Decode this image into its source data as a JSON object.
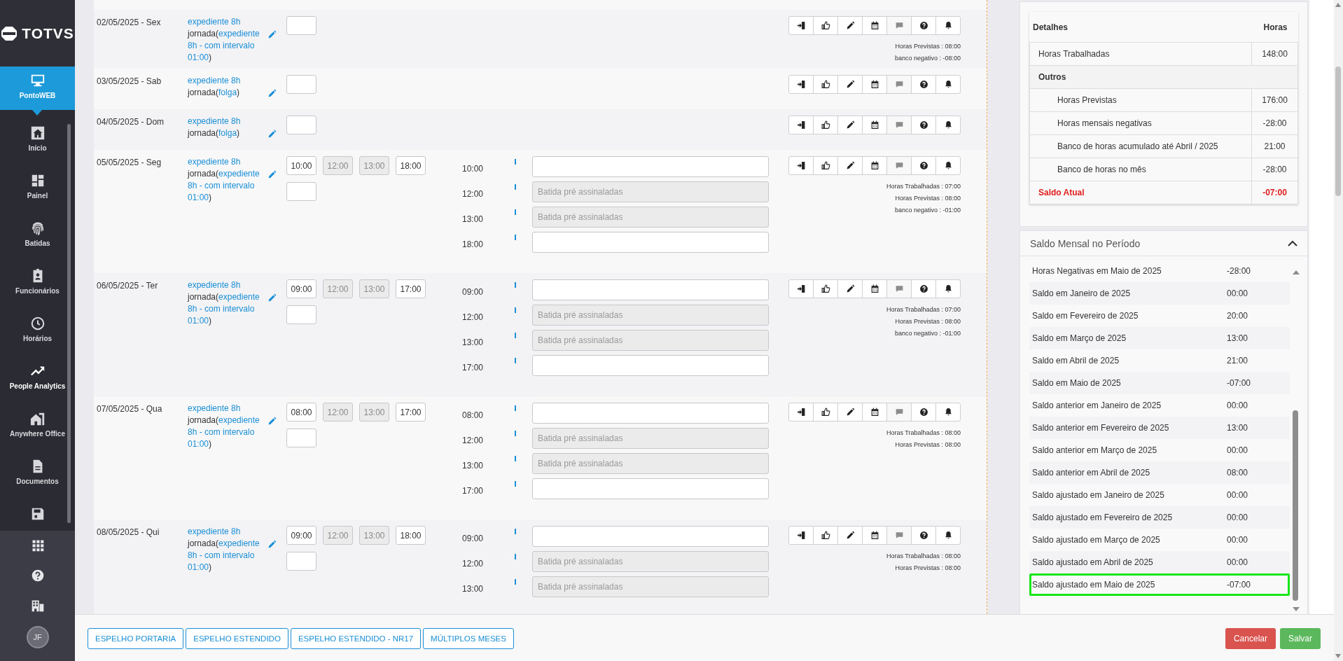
{
  "sidebar": {
    "brand": "TOTVS",
    "nav": [
      {
        "label": "PontoWEB",
        "selected": true,
        "highlighted": false
      },
      {
        "label": "Início",
        "selected": false,
        "highlighted": false
      },
      {
        "label": "Painel",
        "selected": false,
        "highlighted": false
      },
      {
        "label": "Batidas",
        "selected": false,
        "highlighted": false
      },
      {
        "label": "Funcionários",
        "selected": false,
        "highlighted": false
      },
      {
        "label": "Horários",
        "selected": false,
        "highlighted": false
      },
      {
        "label": "People Analytics",
        "selected": false,
        "highlighted": true
      },
      {
        "label": "Anywhere Office",
        "selected": false,
        "highlighted": false
      },
      {
        "label": "Documentos",
        "selected": false,
        "highlighted": false
      },
      {
        "selected": false,
        "highlighted": false
      }
    ],
    "user": {
      "initials": "JF"
    }
  },
  "days": [
    {
      "date": "02/05/2025 - Sex",
      "schedule": "expediente 8h",
      "jornada": "jornada(",
      "jornada_link": "expediente 8h - com intervalo 01:00",
      "jornada_close": ")",
      "inputs": [
        [
          {
            "disabled": false
          }
        ]
      ],
      "actions": [
        {
          "disabled": false
        },
        {
          "disabled": false
        },
        {
          "disabled": false
        },
        {
          "disabled": false
        },
        {
          "disabled": true
        },
        {
          "disabled": false
        },
        {
          "disabled": false
        }
      ],
      "summary": [
        "Horas Previstas : 08:00",
        "banco negativo : -08:00"
      ]
    },
    {
      "date": "03/05/2025 - Sab",
      "schedule": "expediente 8h",
      "jornada": "jornada(",
      "jornada_link": "folga",
      "jornada_close": ")",
      "inputs": [
        [
          {
            "disabled": false
          }
        ]
      ],
      "actions": [
        {
          "disabled": false
        },
        {
          "disabled": false
        },
        {
          "disabled": false
        },
        {
          "disabled": false
        },
        {
          "disabled": true
        },
        {
          "disabled": false
        },
        {
          "disabled": false
        }
      ]
    },
    {
      "date": "04/05/2025 - Dom",
      "schedule": "expediente 8h",
      "jornada": "jornada(",
      "jornada_link": "folga",
      "jornada_close": ")",
      "inputs": [
        [
          {
            "disabled": false
          }
        ]
      ],
      "actions": [
        {
          "disabled": false
        },
        {
          "disabled": false
        },
        {
          "disabled": false
        },
        {
          "disabled": false
        },
        {
          "disabled": true
        },
        {
          "disabled": false
        },
        {
          "disabled": false
        }
      ]
    },
    {
      "date": "05/05/2025 - Seg",
      "schedule": "expediente 8h",
      "jornada": "jornada(",
      "jornada_link": "expediente 8h - com intervalo 01:00",
      "jornada_close": ")",
      "inputs": [
        [
          {
            "value": "10:00",
            "disabled": false
          },
          {
            "value": "12:00",
            "disabled": true
          },
          {
            "value": "13:00",
            "disabled": true
          },
          {
            "value": "18:00",
            "disabled": false
          }
        ],
        [
          {
            "disabled": false
          }
        ]
      ],
      "punches": [
        {
          "time": "10:00",
          "disabled": false
        },
        {
          "time": "12:00",
          "disabled": true,
          "placeholder": "Batida pré assinaladas"
        },
        {
          "time": "13:00",
          "disabled": true,
          "placeholder": "Batida pré assinaladas"
        },
        {
          "time": "18:00",
          "disabled": false
        }
      ],
      "actions": [
        {
          "disabled": false
        },
        {
          "disabled": false
        },
        {
          "disabled": false
        },
        {
          "disabled": false
        },
        {
          "disabled": true
        },
        {
          "disabled": false
        },
        {
          "disabled": false
        }
      ],
      "summary": [
        "Horas Trabalhadas : 07:00",
        "Horas Previstas : 08:00",
        "banco negativo : -01:00"
      ]
    },
    {
      "date": "06/05/2025 - Ter",
      "schedule": "expediente 8h",
      "jornada": "jornada(",
      "jornada_link": "expediente 8h - com intervalo 01:00",
      "jornada_close": ")",
      "inputs": [
        [
          {
            "value": "09:00",
            "disabled": false
          },
          {
            "value": "12:00",
            "disabled": true
          },
          {
            "value": "13:00",
            "disabled": true
          },
          {
            "value": "17:00",
            "disabled": false
          }
        ],
        [
          {
            "disabled": false
          }
        ]
      ],
      "punches": [
        {
          "time": "09:00",
          "disabled": false
        },
        {
          "time": "12:00",
          "disabled": true,
          "placeholder": "Batida pré assinaladas"
        },
        {
          "time": "13:00",
          "disabled": true,
          "placeholder": "Batida pré assinaladas"
        },
        {
          "time": "17:00",
          "disabled": false
        }
      ],
      "actions": [
        {
          "disabled": false
        },
        {
          "disabled": false
        },
        {
          "disabled": false
        },
        {
          "disabled": false
        },
        {
          "disabled": true
        },
        {
          "disabled": false
        },
        {
          "disabled": false
        }
      ],
      "summary": [
        "Horas Trabalhadas : 07:00",
        "Horas Previstas : 08:00",
        "banco negativo : -01:00"
      ]
    },
    {
      "date": "07/05/2025 - Qua",
      "schedule": "expediente 8h",
      "jornada": "jornada(",
      "jornada_link": "expediente 8h - com intervalo 01:00",
      "jornada_close": ")",
      "inputs": [
        [
          {
            "value": "08:00",
            "disabled": false
          },
          {
            "value": "12:00",
            "disabled": true
          },
          {
            "value": "13:00",
            "disabled": true
          },
          {
            "value": "17:00",
            "disabled": false
          }
        ],
        [
          {
            "disabled": false
          }
        ]
      ],
      "punches": [
        {
          "time": "08:00",
          "disabled": false
        },
        {
          "time": "12:00",
          "disabled": true,
          "placeholder": "Batida pré assinaladas"
        },
        {
          "time": "13:00",
          "disabled": true,
          "placeholder": "Batida pré assinaladas"
        },
        {
          "time": "17:00",
          "disabled": false
        }
      ],
      "actions": [
        {
          "disabled": false
        },
        {
          "disabled": false
        },
        {
          "disabled": false
        },
        {
          "disabled": false
        },
        {
          "disabled": true
        },
        {
          "disabled": false
        },
        {
          "disabled": false
        }
      ],
      "summary": [
        "Horas Trabalhadas : 08:00",
        "Horas Previstas : 08:00"
      ]
    },
    {
      "date": "08/05/2025 - Qui",
      "schedule": "expediente 8h",
      "jornada": "jornada(",
      "jornada_link": "expediente 8h - com intervalo 01:00",
      "jornada_close": ")",
      "inputs": [
        [
          {
            "value": "09:00",
            "disabled": false
          },
          {
            "value": "12:00",
            "disabled": true
          },
          {
            "value": "13:00",
            "disabled": true
          },
          {
            "value": "18:00",
            "disabled": false
          }
        ],
        [
          {
            "disabled": false
          }
        ]
      ],
      "punches": [
        {
          "time": "09:00",
          "disabled": false
        },
        {
          "time": "12:00",
          "disabled": true,
          "placeholder": "Batida pré assinaladas"
        },
        {
          "time": "13:00",
          "disabled": true,
          "placeholder": "Batida pré assinaladas"
        }
      ],
      "actions": [
        {
          "disabled": false
        },
        {
          "disabled": false
        },
        {
          "disabled": false
        },
        {
          "disabled": false
        },
        {
          "disabled": true
        },
        {
          "disabled": false
        },
        {
          "disabled": false
        }
      ],
      "summary": [
        "Horas Trabalhadas : 08:00",
        "Horas Previstas : 08:00"
      ]
    }
  ],
  "details": {
    "columns": [
      "Detalhes",
      "Horas"
    ],
    "rows": [
      {
        "kind": "item",
        "label": "Horas Trabalhadas",
        "value": "148:00"
      },
      {
        "kind": "group",
        "label": "Outros",
        "children": [
          {
            "kind": "item",
            "label": "Horas Previstas",
            "value": "176:00"
          },
          {
            "kind": "item",
            "label": "Horas mensais negativas",
            "value": "-28:00"
          },
          {
            "kind": "item",
            "label": "Banco de horas acumulado até Abril / 2025",
            "value": "21:00"
          },
          {
            "kind": "item",
            "label": "Banco de horas no mês",
            "value": "-28:00"
          }
        ]
      },
      {
        "kind": "total",
        "label": "Saldo Atual",
        "value": "-07:00"
      }
    ]
  },
  "monthly_balance": {
    "title": "Saldo Mensal no Período",
    "expanded": true,
    "rows": [
      {
        "label": "Horas Negativas em Maio de 2025",
        "value": "-28:00",
        "selected": false
      },
      {
        "label": "Saldo em Janeiro de 2025",
        "value": "00:00",
        "selected": false
      },
      {
        "label": "Saldo em Fevereiro de 2025",
        "value": "20:00",
        "selected": false
      },
      {
        "label": "Saldo em Março de 2025",
        "value": "13:00",
        "selected": false
      },
      {
        "label": "Saldo em Abril de 2025",
        "value": "21:00",
        "selected": false
      },
      {
        "label": "Saldo em Maio de 2025",
        "value": "-07:00",
        "selected": false
      },
      {
        "label": "Saldo anterior em Janeiro de 2025",
        "value": "00:00",
        "selected": false
      },
      {
        "label": "Saldo anterior em Fevereiro de 2025",
        "value": "13:00",
        "selected": false
      },
      {
        "label": "Saldo anterior em Março de 2025",
        "value": "00:00",
        "selected": false
      },
      {
        "label": "Saldo anterior em Abril de 2025",
        "value": "08:00",
        "selected": false
      },
      {
        "label": "Saldo ajustado em Janeiro de 2025",
        "value": "00:00",
        "selected": false
      },
      {
        "label": "Saldo ajustado em Fevereiro de 2025",
        "value": "00:00",
        "selected": false
      },
      {
        "label": "Saldo ajustado em Março de 2025",
        "value": "00:00",
        "selected": false
      },
      {
        "label": "Saldo ajustado em Abril de 2025",
        "value": "00:00",
        "selected": false
      },
      {
        "label": "Saldo ajustado em Maio de 2025",
        "value": "-07:00",
        "selected": true
      }
    ]
  },
  "footer": {
    "report_buttons": [
      "ESPELHO PORTARIA",
      "ESPELHO ESTENDIDO",
      "ESPELHO ESTENDIDO - NR17",
      "MÚLTIPLOS MESES"
    ],
    "actions": [
      {
        "kind": "danger",
        "label": "Cancelar"
      },
      {
        "kind": "success",
        "label": "Salvar"
      }
    ]
  }
}
